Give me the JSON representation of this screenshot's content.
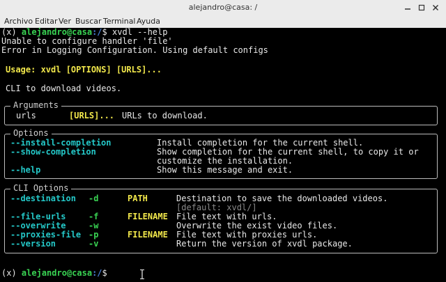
{
  "window": {
    "title": "alejandro@casa: /"
  },
  "menu": [
    "Archivo",
    "Editar",
    "Ver",
    "Buscar",
    "Terminal",
    "Ayuda"
  ],
  "prompt": {
    "env": "(x)",
    "user_host": "alejandro@casa",
    "path": ":/",
    "dollar": "$",
    "command": "xvdl --help"
  },
  "output": {
    "line1": "Unable to configure handler 'file'",
    "line2": "Error in Logging Configuration. Using default configs",
    "usage": "Usage: xvdl [OPTIONS] [URLS]...",
    "description": "CLI to download videos."
  },
  "arguments": {
    "title": "Arguments",
    "name": "urls",
    "metavar": "[URLS]...",
    "desc": "URLs to download."
  },
  "options": {
    "title": "Options",
    "items": [
      {
        "flag": "--install-completion",
        "desc": "Install completion for the current shell."
      },
      {
        "flag": "--show-completion",
        "desc": "Show completion for the current shell, to copy it or",
        "desc2": "customize the installation."
      },
      {
        "flag": "--help",
        "desc": "Show this message and exit."
      }
    ]
  },
  "cli_options": {
    "title": "CLI Options",
    "items": [
      {
        "flag": "--destination",
        "short": "-d",
        "metavar": "PATH",
        "desc": "Destination to save the downloaded videos.",
        "default": "[default: xvdl/]"
      },
      {
        "flag": "--file-urls",
        "short": "-f",
        "metavar": "FILENAME",
        "desc": "File text with urls."
      },
      {
        "flag": "--overwrite",
        "short": "-w",
        "metavar": "",
        "desc": "Overwrite the exist video files."
      },
      {
        "flag": "--proxies-file",
        "short": "-p",
        "metavar": "FILENAME",
        "desc": "File text with proxies urls."
      },
      {
        "flag": "--version",
        "short": "-v",
        "metavar": "",
        "desc": "Return the version of xvdl package."
      }
    ]
  },
  "prompt2": {
    "env": "(x)",
    "user_host": "alejandro@casa",
    "path": ":/",
    "dollar": "$"
  },
  "colors": {
    "background": "#000000",
    "prompt_user": "#39d353",
    "prompt_path": "#4a7fd6",
    "option_flag": "#24c8c8",
    "metavar": "#f2e84b"
  }
}
